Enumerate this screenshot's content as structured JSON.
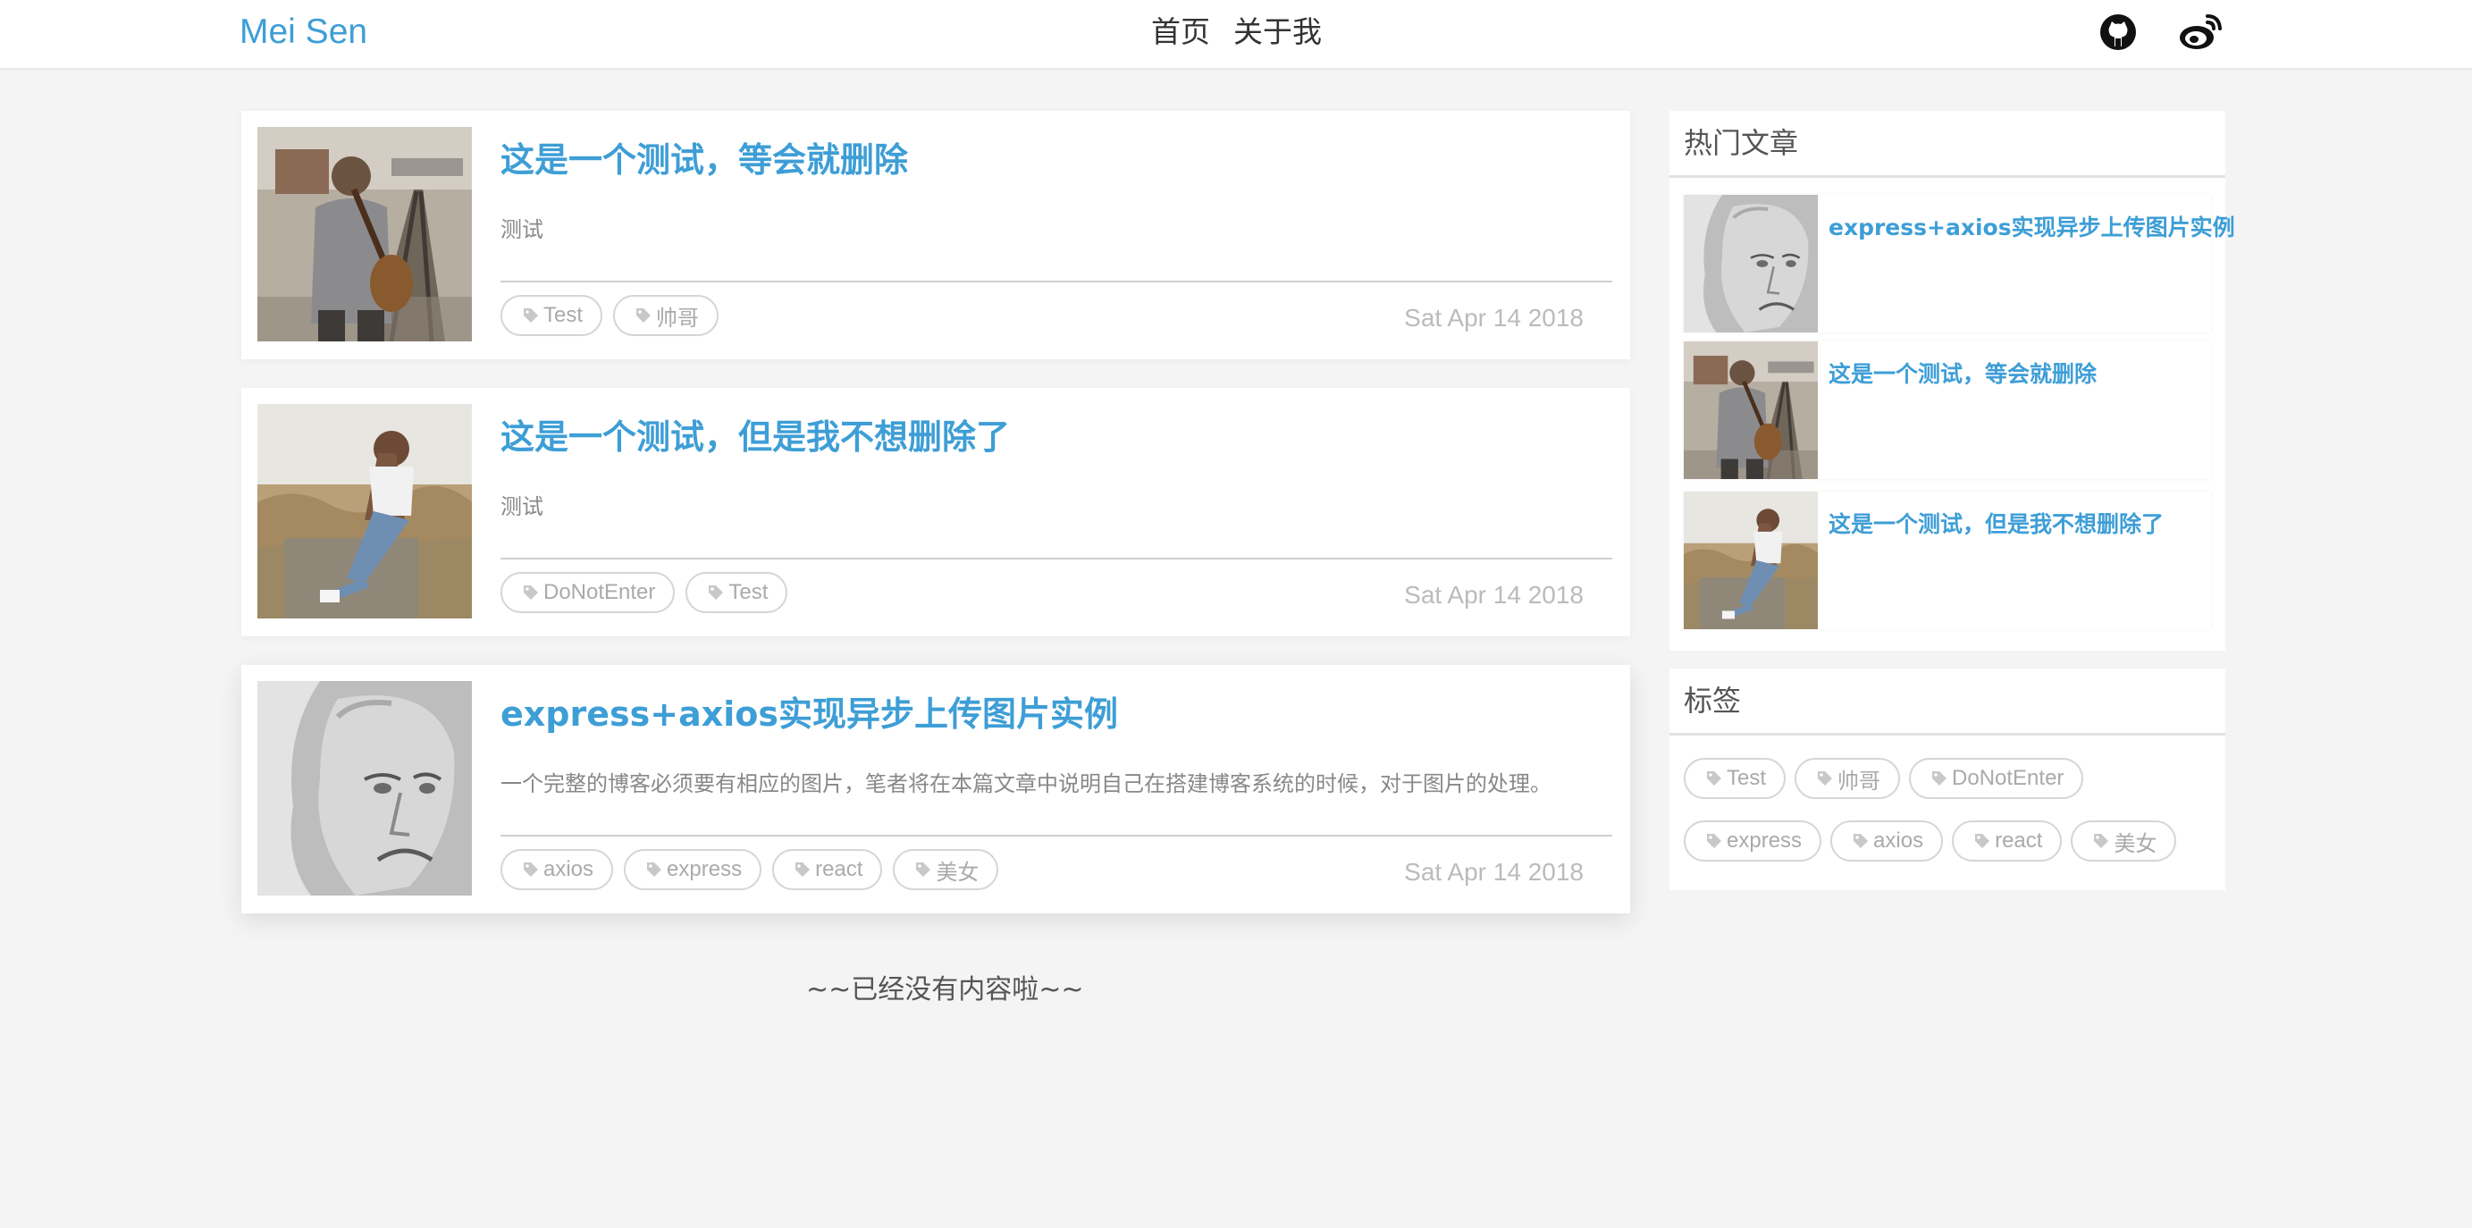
{
  "header": {
    "brand": "Mei Sen",
    "nav": [
      "首页",
      "关于我"
    ],
    "icons": [
      "github-icon",
      "weibo-icon"
    ]
  },
  "articles": [
    {
      "title": "这是一个测试，等会就删除",
      "summary": "测试",
      "tags": [
        "Test",
        "帅哥"
      ],
      "date": "Sat Apr 14 2018",
      "image": "man-with-guitar-on-railway"
    },
    {
      "title": "这是一个测试，但是我不想删除了",
      "summary": "测试",
      "tags": [
        "DoNotEnter",
        "Test"
      ],
      "date": "Sat Apr 14 2018",
      "image": "woman-sitting-in-field"
    },
    {
      "title": "express+axios实现异步上传图片实例",
      "summary": "一个完整的博客必须要有相应的图片，笔者将在本篇文章中说明自己在搭建博客系统的时候，对于图片的处理。",
      "tags": [
        "axios",
        "express",
        "react",
        "美女"
      ],
      "date": "Sat Apr 14 2018",
      "image": "old-man-portrait"
    }
  ],
  "end_text": "~~已经没有内容啦~~",
  "sidebar": {
    "hot": {
      "title": "热门文章",
      "items": [
        {
          "title": "express+axios实现异步上传图片实例",
          "image": "old-man-portrait"
        },
        {
          "title": "这是一个测试，等会就删除",
          "image": "man-with-guitar-on-railway"
        },
        {
          "title": "这是一个测试，但是我不想删除了",
          "image": "woman-sitting-in-field"
        }
      ]
    },
    "tags": {
      "title": "标签",
      "items": [
        "Test",
        "帅哥",
        "DoNotEnter",
        "express",
        "axios",
        "react",
        "美女"
      ]
    }
  },
  "colors": {
    "accent": "#3e9ed6",
    "background": "#f4f4f4",
    "muted": "#aaaaaa"
  }
}
